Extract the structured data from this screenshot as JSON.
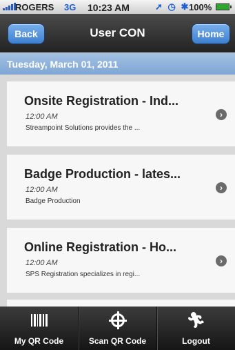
{
  "status_bar": {
    "carrier": "ROGERS",
    "network": "3G",
    "time": "10:23 AM",
    "battery": "100%"
  },
  "nav_bar": {
    "back_label": "Back",
    "title": "User CON",
    "home_label": "Home"
  },
  "date_header": "Tuesday, March 01, 2011",
  "sessions": [
    {
      "title": "Onsite Registration - Ind...",
      "time": "12:00 AM",
      "description": "Streampoint Solutions provides the ..."
    },
    {
      "title": "Badge Production - lates...",
      "time": "12:00 AM",
      "description": "Badge Production"
    },
    {
      "title": "Online Registration - Ho...",
      "time": "12:00 AM",
      "description": "SPS Registration specializes in regi..."
    }
  ],
  "tab_bar": {
    "tabs": [
      {
        "label": "My QR Code",
        "icon": "barcode-icon"
      },
      {
        "label": "Scan QR Code",
        "icon": "target-icon"
      },
      {
        "label": "Logout",
        "icon": "runner-icon"
      }
    ]
  },
  "colors": {
    "accent_button": "#3d7fd0",
    "date_header": "#7fa6d5",
    "nav_bar": "#232323"
  }
}
